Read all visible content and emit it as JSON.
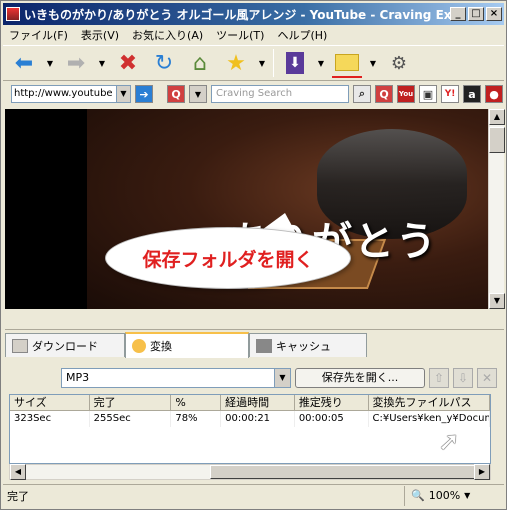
{
  "window": {
    "title": "いきものがかり/ありがとう オルゴール風アレンジ - YouTube - Craving Explo...",
    "min_label": "_",
    "max_label": "□",
    "close_label": "×"
  },
  "menu": [
    "ファイル(F)",
    "表示(V)",
    "お気に入り(A)",
    "ツール(T)",
    "ヘルプ(H)"
  ],
  "toolbar": {
    "icons": [
      "back-arrow-icon",
      "forward-arrow-icon",
      "stop-icon",
      "refresh-icon",
      "home-icon",
      "favorites-star-icon",
      "download-icon",
      "folder-icon",
      "settings-icon"
    ]
  },
  "address": {
    "value": "http://www.youtube",
    "search_placeholder": "Craving Search"
  },
  "video": {
    "lyric_text": "ありがとう",
    "callout_text": "保存フォルダを開く"
  },
  "tabs": [
    {
      "label": "ダウンロード",
      "active": false
    },
    {
      "label": "変換",
      "active": true
    },
    {
      "label": "キャッシュ",
      "active": false
    }
  ],
  "convert": {
    "format": "MP3",
    "open_folder_label": "保存先を開く..."
  },
  "table": {
    "headers": [
      "サイズ",
      "完了",
      "%",
      "経過時間",
      "推定残り",
      "変換先ファイルパス"
    ],
    "rows": [
      [
        "323Sec",
        "255Sec",
        "78%",
        "00:00:21",
        "00:00:05",
        "C:¥Users¥ken_y¥Docume"
      ]
    ]
  },
  "status": {
    "text": "完了",
    "zoom": "100%"
  },
  "colors": {
    "title_start": "#0a246a",
    "callout_text": "#e02020",
    "stop": "#d03030",
    "refresh": "#2a7fd4"
  }
}
